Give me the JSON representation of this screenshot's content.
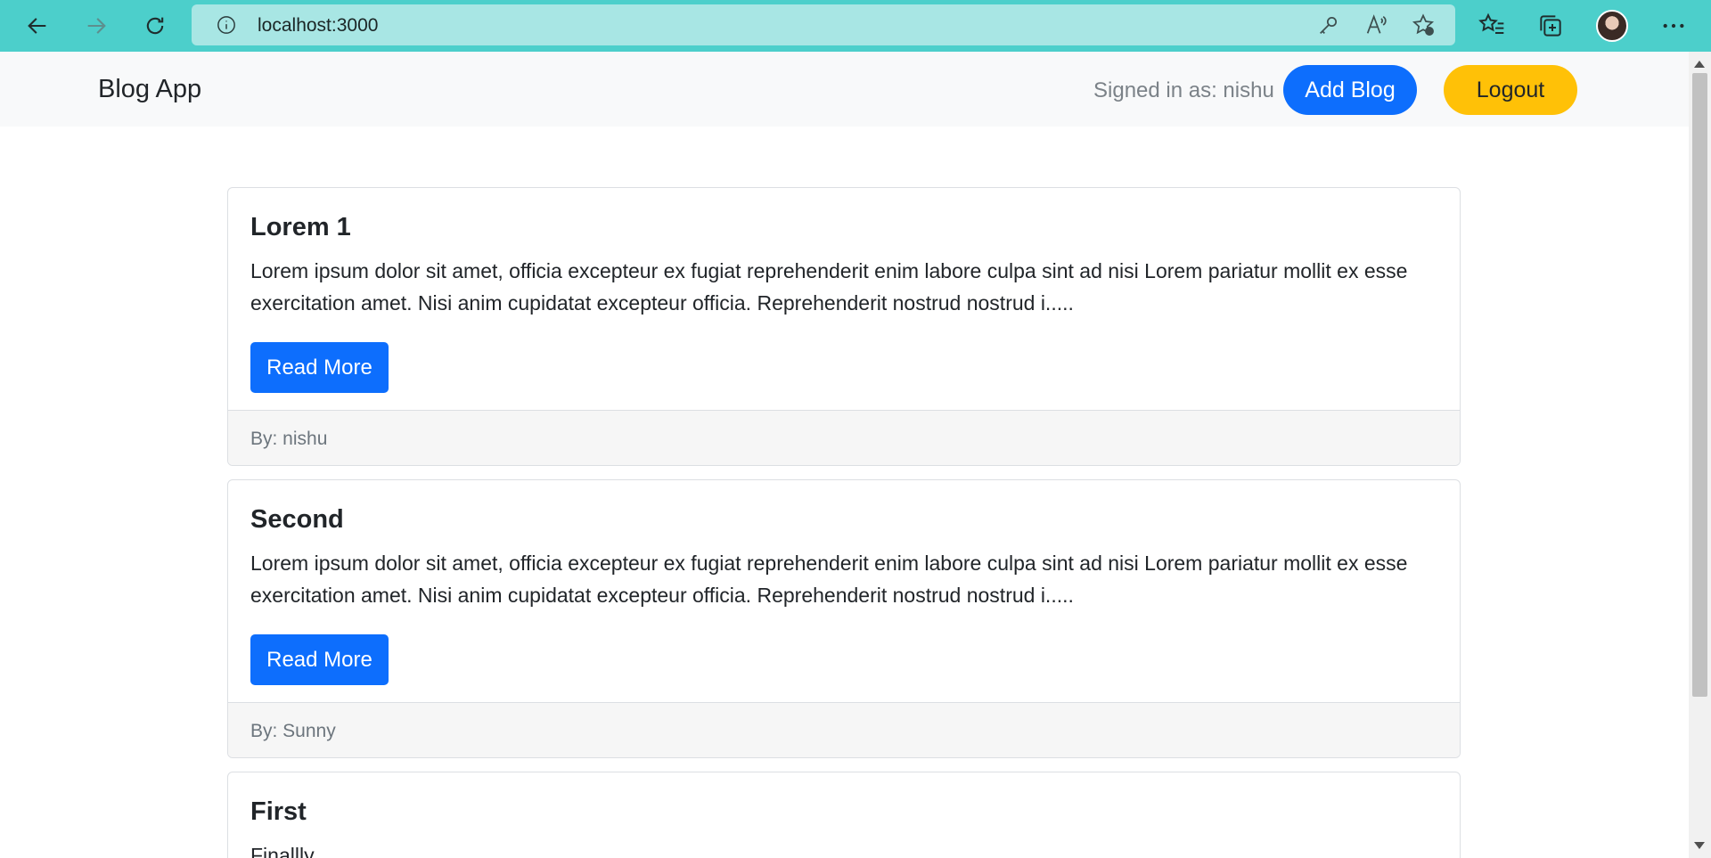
{
  "browser": {
    "url": "localhost:3000"
  },
  "navbar": {
    "brand": "Blog App",
    "signed_in": "Signed in as: nishu",
    "add_blog_label": "Add Blog",
    "logout_label": "Logout"
  },
  "posts": [
    {
      "title": "Lorem 1",
      "excerpt": "Lorem ipsum dolor sit amet, officia excepteur ex fugiat reprehenderit enim labore culpa sint ad nisi Lorem pariatur mollit ex esse exercitation amet. Nisi anim cupidatat excepteur officia. Reprehenderit nostrud nostrud i.....",
      "read_more_label": "Read More",
      "author": "By: nishu"
    },
    {
      "title": "Second",
      "excerpt": "Lorem ipsum dolor sit amet, officia excepteur ex fugiat reprehenderit enim labore culpa sint ad nisi Lorem pariatur mollit ex esse exercitation amet. Nisi anim cupidatat excepteur officia. Reprehenderit nostrud nostrud i.....",
      "read_more_label": "Read More",
      "author": "By: Sunny"
    },
    {
      "title": "First",
      "excerpt": "Finallly"
    }
  ],
  "colors": {
    "primary": "#0d6efd",
    "warning": "#ffc107",
    "browser_accent": "#4ccfcb"
  }
}
